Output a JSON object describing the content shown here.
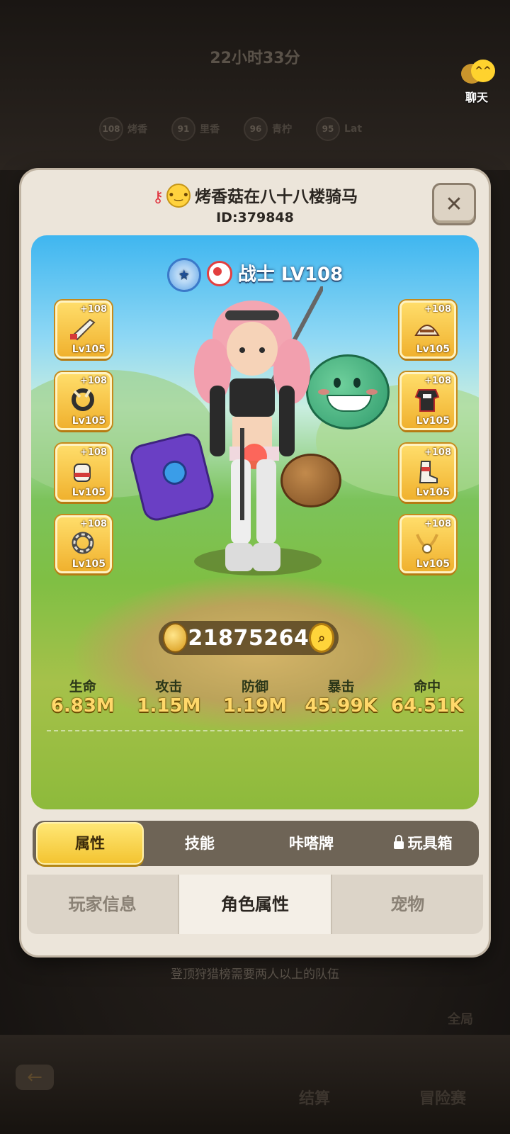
{
  "background": {
    "timer": "22小时33分",
    "ranks": [
      {
        "num": "108",
        "name": "烤香"
      },
      {
        "num": "91",
        "name": "里香"
      },
      {
        "num": "96",
        "name": "青柠"
      },
      {
        "num": "95",
        "name": "Lat"
      }
    ],
    "chat_label": "聊天",
    "hint": "登顶狩猎榜需要两人以上的队伍",
    "bottom_settle": "结算",
    "bottom_adventure": "冒险赛",
    "bottom_global": "全局"
  },
  "player": {
    "name": "烤香菇在八十八楼骑马",
    "id": "ID:379848"
  },
  "character": {
    "class_label": "战士 LV108",
    "power": "21875264",
    "equipment_left": [
      {
        "plus": "+108",
        "lv": "Lv105",
        "icon": "weapon-icon"
      },
      {
        "plus": "+108",
        "lv": "Lv105",
        "icon": "ring-icon"
      },
      {
        "plus": "+108",
        "lv": "Lv105",
        "icon": "glove-icon"
      },
      {
        "plus": "+108",
        "lv": "Lv105",
        "icon": "bracelet-icon"
      }
    ],
    "equipment_right": [
      {
        "plus": "+108",
        "lv": "Lv105",
        "icon": "helmet-icon"
      },
      {
        "plus": "+108",
        "lv": "Lv105",
        "icon": "armor-icon"
      },
      {
        "plus": "+108",
        "lv": "Lv105",
        "icon": "boots-icon"
      },
      {
        "plus": "+108",
        "lv": "Lv105",
        "icon": "necklace-icon"
      }
    ],
    "stats": [
      {
        "label": "生命",
        "value": "6.83M"
      },
      {
        "label": "攻击",
        "value": "1.15M"
      },
      {
        "label": "防御",
        "value": "1.19M"
      },
      {
        "label": "暴击",
        "value": "45.99K"
      },
      {
        "label": "命中",
        "value": "64.51K"
      }
    ]
  },
  "sub_tabs": [
    "属性",
    "技能",
    "咔嗒牌",
    "玩具箱"
  ],
  "main_tabs": [
    "玩家信息",
    "角色属性",
    "宠物"
  ],
  "close_symbol": "✕",
  "colors": {
    "accent_yellow": "#f3c431",
    "stat_value": "#ffd86a",
    "panel_bg": "#ece5da"
  }
}
